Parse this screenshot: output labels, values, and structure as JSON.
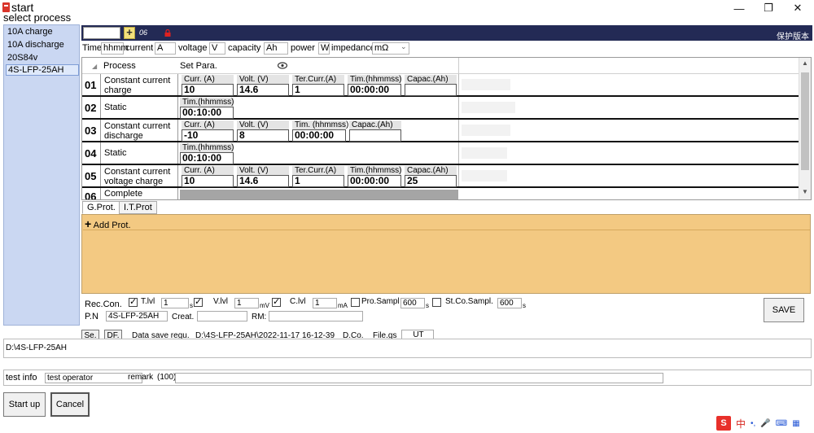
{
  "window": {
    "title": "start",
    "min": "—",
    "max": "❐",
    "close": "✕"
  },
  "process_header": "select process",
  "process_list": [
    "10A charge",
    "10A discharge",
    "20S84v",
    "4S-LFP-25AH"
  ],
  "toolbar": {
    "code": "06",
    "right_text": "保护版本"
  },
  "units": {
    "time_label": "Time",
    "time_unit": "hhmm",
    "current_label": "current",
    "current_unit": "A",
    "voltage_label": "voltage",
    "voltage_unit": "V",
    "capacity_label": "capacity",
    "capacity_unit": "Ah",
    "power_label": "power",
    "power_unit": "W",
    "impedance_label": "impedance",
    "impedance_unit": "mΩ"
  },
  "grid": {
    "col_process": "Process",
    "col_set_para": "Set Para.",
    "rows": [
      {
        "num": "01",
        "name": "Constant current charge",
        "params": [
          {
            "label": "Curr.   (A)",
            "value": "10"
          },
          {
            "label": "Volt.   (V)",
            "value": "14.6"
          },
          {
            "label": "Ter.Curr.(A)",
            "value": "1"
          },
          {
            "label": "Tim.(hhmmss)",
            "value": "00:00:00"
          },
          {
            "label": "Capac.(Ah)",
            "value": ""
          }
        ]
      },
      {
        "num": "02",
        "name": "Static",
        "params": [
          {
            "label": "Tim.(hhmmss)",
            "value": "00:10:00"
          }
        ]
      },
      {
        "num": "03",
        "name": "Constant current discharge",
        "params": [
          {
            "label": "Curr.   (A)",
            "value": "-10"
          },
          {
            "label": "Volt.   (V)",
            "value": "8"
          },
          {
            "label": "Tim. (hhmmss)",
            "value": "00:00:00"
          },
          {
            "label": "Capac.(Ah)",
            "value": ""
          }
        ]
      },
      {
        "num": "04",
        "name": "Static",
        "params": [
          {
            "label": "Tim.(hhmmss)",
            "value": "00:10:00"
          }
        ]
      },
      {
        "num": "05",
        "name": "Constant current voltage charge",
        "params": [
          {
            "label": "Curr.   (A)",
            "value": "10"
          },
          {
            "label": "Volt.   (V)",
            "value": "14.6"
          },
          {
            "label": "Ter.Curr.(A)",
            "value": "1"
          },
          {
            "label": "Tim.(hhmmss)",
            "value": "00:00:00"
          },
          {
            "label": "Capac.(Ah)",
            "value": "25"
          }
        ]
      },
      {
        "num": "06",
        "name": "Complete",
        "params": []
      }
    ]
  },
  "prot_tabs": [
    "G.Prot.",
    "I.T.Prot"
  ],
  "add_prot": "Add Prot.",
  "record": {
    "rec_con": "Rec.Con.",
    "t_lvl": "T.lvl",
    "t_val": "1",
    "t_unit": "s",
    "v_lvl": "V.lvl",
    "v_val": "1",
    "v_unit": "mV",
    "c_lvl": "C.lvl",
    "c_val": "1",
    "c_unit": "mA",
    "pro_sampl": "Pro.Sampl",
    "pro_val": "600",
    "pro_unit": "s",
    "st_sampl": "St.Co.Sampl.",
    "st_val": "600",
    "st_unit": "s",
    "pn_label": "P.N",
    "pn_value": "4S-LFP-25AH",
    "creat_label": "Creat.",
    "rm_label": "RM:",
    "save": "SAVE"
  },
  "data_save": {
    "se": "Se.",
    "df": "DF.",
    "label": "Data save regu.",
    "path": "D:\\4S-LFP-25AH\\2022-11-17 16-12-39",
    "dco": "D.Co.",
    "file_label": "File.gs",
    "file_value": "UT",
    "dir": "D:\\4S-LFP-25AH"
  },
  "test_info": {
    "label": "test info",
    "operator": "test operator",
    "remark_label": "remark",
    "remark_limit": "(100)"
  },
  "buttons": {
    "startup": "Start up",
    "cancel": "Cancel"
  },
  "ime": {
    "zh": "中",
    "dot": "•,",
    "mic": "🎤",
    "kbd": "⌨",
    "grid": "▦"
  },
  "colors": {
    "toolbar_bg": "#232a55",
    "prot_bg": "#f3c982",
    "list_bg": "#cad7f2"
  }
}
